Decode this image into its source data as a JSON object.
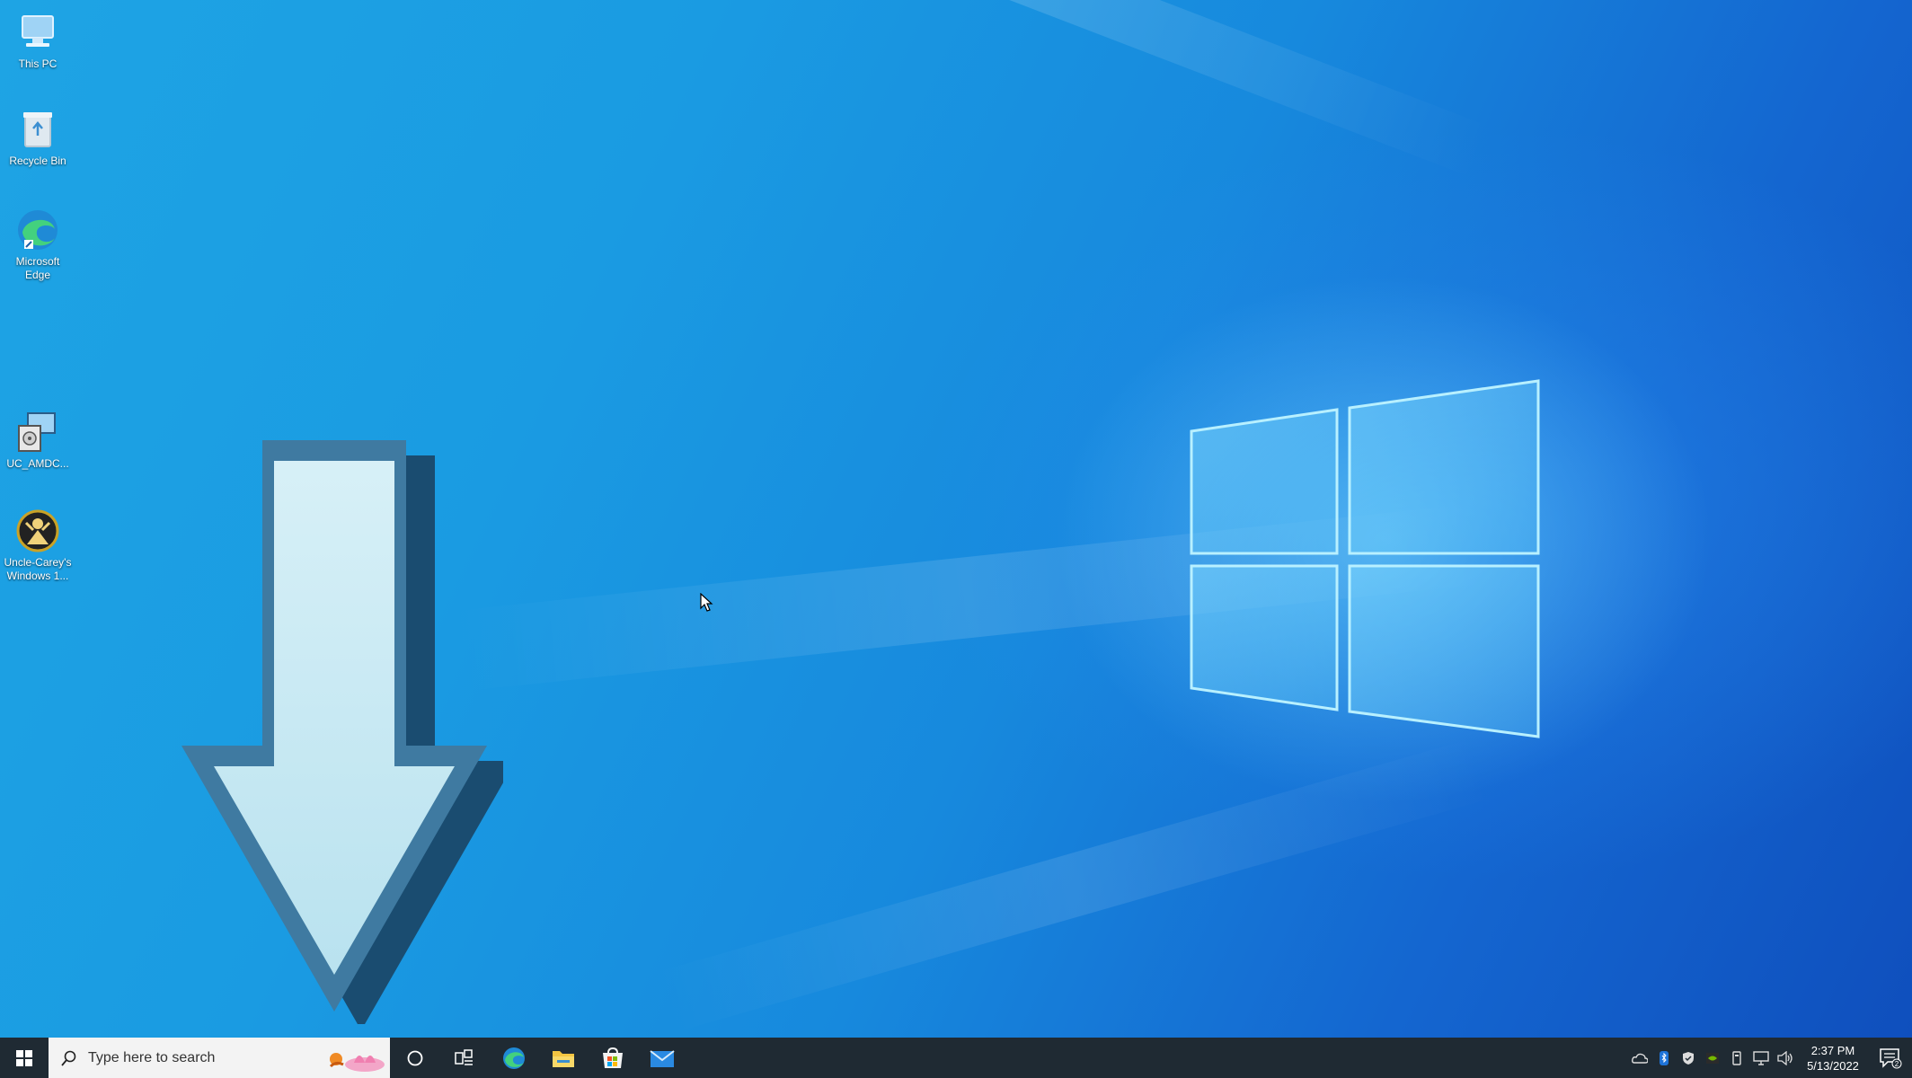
{
  "desktop": {
    "icons": [
      {
        "label": "This PC",
        "icon": "this-pc-icon"
      },
      {
        "label": "Recycle Bin",
        "icon": "recycle-bin-icon"
      },
      {
        "label": "Microsoft Edge",
        "icon": "edge-icon"
      },
      {
        "label": "UC_AMDC...",
        "icon": "installer-icon"
      },
      {
        "label": "Uncle-Carey's Windows 1...",
        "icon": "uncle-carey-icon"
      }
    ]
  },
  "taskbar": {
    "search_placeholder": "Type here to search",
    "apps": [
      "cortana-icon",
      "task-view-icon",
      "edge-icon",
      "file-explorer-icon",
      "store-icon",
      "mail-icon"
    ],
    "clock": {
      "time": "2:37 PM",
      "date": "5/13/2022"
    },
    "notification_count": "2"
  },
  "colors": {
    "taskbar": "#1f2a33",
    "accent": "#1ea4e4"
  }
}
